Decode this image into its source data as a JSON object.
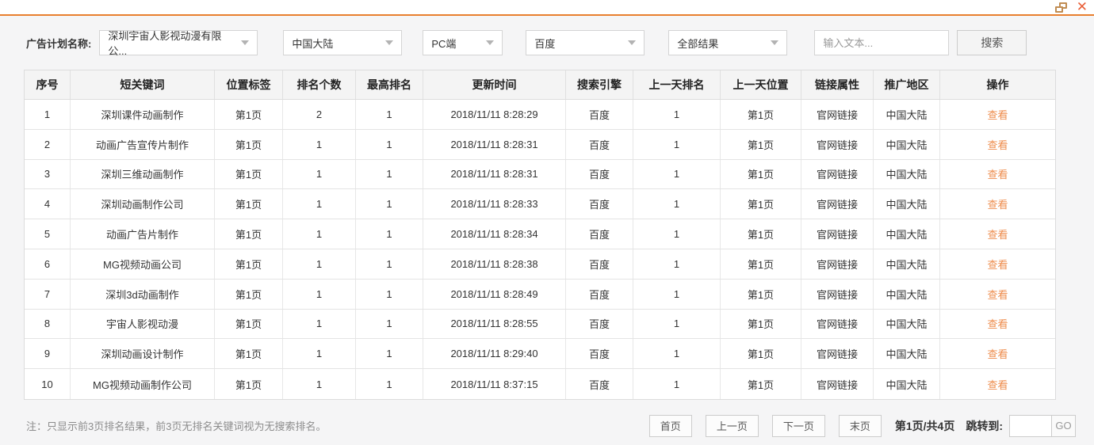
{
  "window": {
    "close_glyph": "✕"
  },
  "filters": {
    "label": "广告计划名称:",
    "plan_selected": "深圳宇宙人影视动漫有限公...",
    "region_selected": "中国大陆",
    "device_selected": "PC端",
    "engine_selected": "百度",
    "result_selected": "全部结果",
    "keyword_placeholder": "输入文本...",
    "search_button": "搜索"
  },
  "table": {
    "columns": [
      {
        "key": "index",
        "label": "序号"
      },
      {
        "key": "keyword",
        "label": "短关键词"
      },
      {
        "key": "position-tag",
        "label": "位置标签"
      },
      {
        "key": "rank-count",
        "label": "排名个数"
      },
      {
        "key": "best-rank",
        "label": "最高排名"
      },
      {
        "key": "update-time",
        "label": "更新时间"
      },
      {
        "key": "search-engine",
        "label": "搜索引擎"
      },
      {
        "key": "prev-day-rank",
        "label": "上一天排名"
      },
      {
        "key": "prev-day-position",
        "label": "上一天位置"
      },
      {
        "key": "link-attribute",
        "label": "链接属性"
      },
      {
        "key": "promo-region",
        "label": "推广地区"
      },
      {
        "key": "action",
        "label": "操作"
      }
    ],
    "rows": [
      [
        "1",
        "深圳课件动画制作",
        "第1页",
        "2",
        "1",
        "2018/11/11 8:28:29",
        "百度",
        "1",
        "第1页",
        "官网链接",
        "中国大陆",
        "查看"
      ],
      [
        "2",
        "动画广告宣传片制作",
        "第1页",
        "1",
        "1",
        "2018/11/11 8:28:31",
        "百度",
        "1",
        "第1页",
        "官网链接",
        "中国大陆",
        "查看"
      ],
      [
        "3",
        "深圳三维动画制作",
        "第1页",
        "1",
        "1",
        "2018/11/11 8:28:31",
        "百度",
        "1",
        "第1页",
        "官网链接",
        "中国大陆",
        "查看"
      ],
      [
        "4",
        "深圳动画制作公司",
        "第1页",
        "1",
        "1",
        "2018/11/11 8:28:33",
        "百度",
        "1",
        "第1页",
        "官网链接",
        "中国大陆",
        "查看"
      ],
      [
        "5",
        "动画广告片制作",
        "第1页",
        "1",
        "1",
        "2018/11/11 8:28:34",
        "百度",
        "1",
        "第1页",
        "官网链接",
        "中国大陆",
        "查看"
      ],
      [
        "6",
        "MG视频动画公司",
        "第1页",
        "1",
        "1",
        "2018/11/11 8:28:38",
        "百度",
        "1",
        "第1页",
        "官网链接",
        "中国大陆",
        "查看"
      ],
      [
        "7",
        "深圳3d动画制作",
        "第1页",
        "1",
        "1",
        "2018/11/11 8:28:49",
        "百度",
        "1",
        "第1页",
        "官网链接",
        "中国大陆",
        "查看"
      ],
      [
        "8",
        "宇宙人影视动漫",
        "第1页",
        "1",
        "1",
        "2018/11/11 8:28:55",
        "百度",
        "1",
        "第1页",
        "官网链接",
        "中国大陆",
        "查看"
      ],
      [
        "9",
        "深圳动画设计制作",
        "第1页",
        "1",
        "1",
        "2018/11/11 8:29:40",
        "百度",
        "1",
        "第1页",
        "官网链接",
        "中国大陆",
        "查看"
      ],
      [
        "10",
        "MG视频动画制作公司",
        "第1页",
        "1",
        "1",
        "2018/11/11 8:37:15",
        "百度",
        "1",
        "第1页",
        "官网链接",
        "中国大陆",
        "查看"
      ]
    ]
  },
  "footer": {
    "note": "注：只显示前3页排名结果，前3页无排名关键词视为无搜索排名。",
    "pagination": {
      "first": "首页",
      "prev": "上一页",
      "next": "下一页",
      "last": "末页",
      "page_info": "第1页/共4页",
      "jump_label": "跳转到:",
      "jump_value": "",
      "go": "GO"
    }
  },
  "colors": {
    "accent_orange": "#e87f2e",
    "link_orange": "#ee8c4c",
    "close_red": "#e95f38",
    "restore_brown": "#c08c52"
  }
}
